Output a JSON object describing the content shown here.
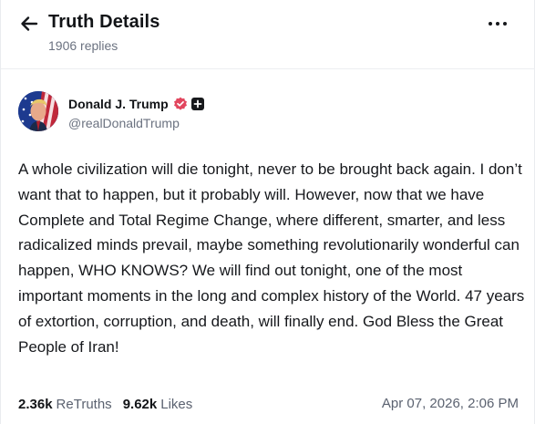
{
  "header": {
    "title": "Truth Details",
    "replies": "1906 replies"
  },
  "post": {
    "author": {
      "display_name": "Donald J. Trump",
      "handle": "@realDonaldTrump",
      "verified": true
    },
    "text": "A whole civilization will die tonight, never to be brought back again. I don’t want that to happen, but it probably will. However, now that we have Complete and Total Regime Change, where different, smarter, and less radicalized minds prevail, maybe something revolutionarily wonderful can happen, WHO KNOWS? We will find out tonight, one of the most important moments in the long and complex history of the World. 47 years of extortion, corruption, and death, will finally end. God Bless the Great People of Iran!",
    "retruths_count": "2.36k",
    "retruths_label": "ReTruths",
    "likes_count": "9.62k",
    "likes_label": "Likes",
    "timestamp": "Apr 07, 2026, 2:06 PM"
  },
  "icons": {
    "back": "arrow-left-icon",
    "more": "more-horizontal-icon",
    "verified": "verified-badge-icon",
    "plus": "plus-badge-icon"
  },
  "colors": {
    "verified_badge": "#e2465e",
    "muted_text": "#6b7280",
    "primary_text": "#16181c"
  }
}
